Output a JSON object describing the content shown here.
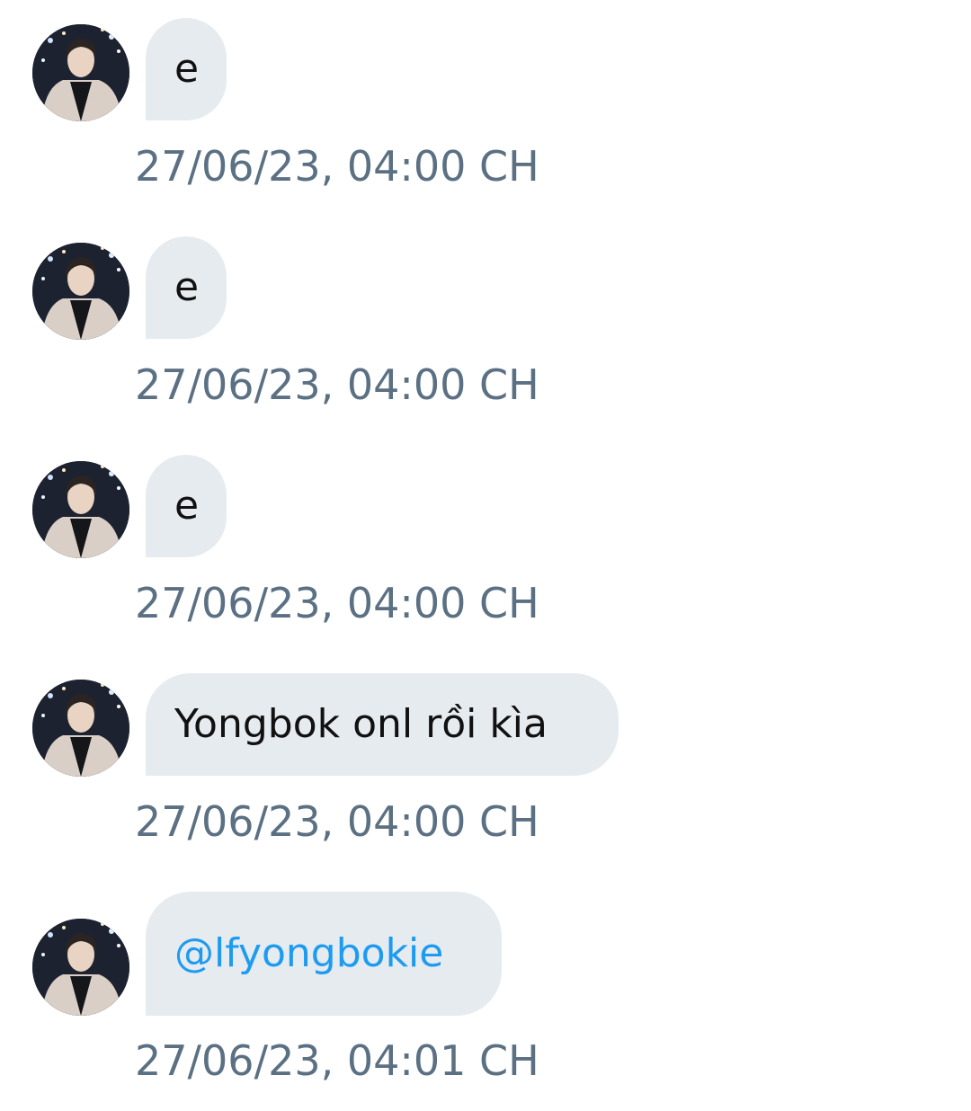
{
  "messages": [
    {
      "text": "e",
      "timestamp": "27/06/23, 04:00 CH",
      "type": "text"
    },
    {
      "text": "e",
      "timestamp": "27/06/23, 04:00 CH",
      "type": "text"
    },
    {
      "text": "e",
      "timestamp": "27/06/23, 04:00 CH",
      "type": "text"
    },
    {
      "text": "Yongbok onl rồi kìa",
      "timestamp": "27/06/23, 04:00 CH",
      "type": "text"
    },
    {
      "text": "@lfyongbokie",
      "timestamp": "27/06/23, 04:01 CH",
      "type": "mention"
    }
  ],
  "colors": {
    "bubble_bg": "#e6ebf0",
    "message_text": "#111111",
    "mention_text": "#1d9bf0",
    "timestamp_text": "#5b7083"
  },
  "icons": {
    "avatar": "user-avatar-photo"
  }
}
